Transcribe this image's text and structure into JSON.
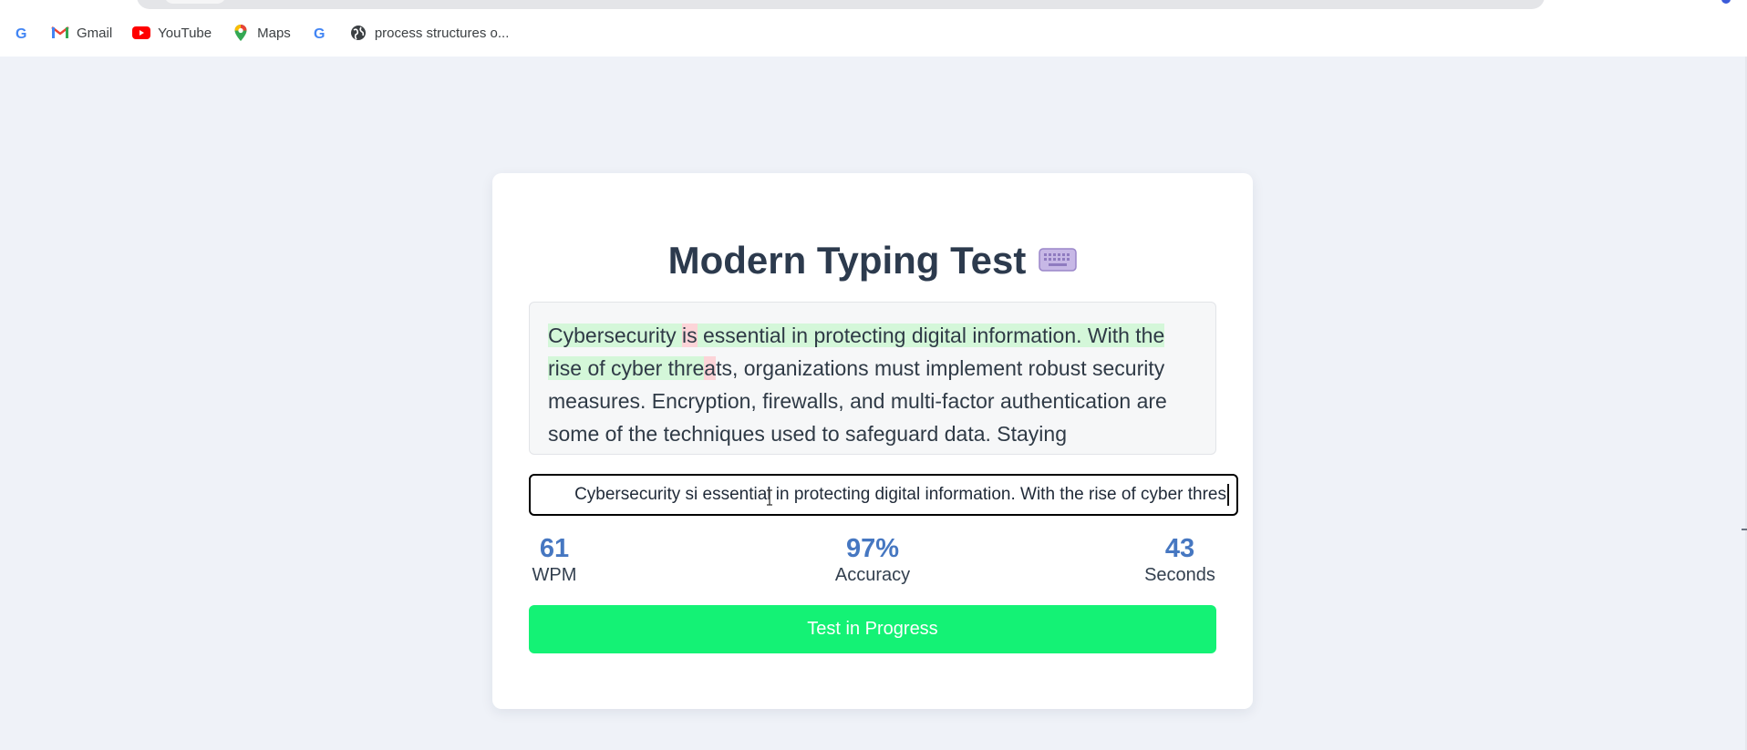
{
  "browser": {
    "bookmarks": [
      {
        "label": "",
        "icon": "google-icon"
      },
      {
        "label": "Gmail",
        "icon": "gmail-icon"
      },
      {
        "label": "YouTube",
        "icon": "youtube-icon"
      },
      {
        "label": "Maps",
        "icon": "maps-icon"
      },
      {
        "label": "",
        "icon": "google-icon"
      },
      {
        "label": "process structures o...",
        "icon": "globe-icon"
      }
    ]
  },
  "app": {
    "title": "Modern Typing Test",
    "title_icon": "keyboard-icon",
    "passage": {
      "segments": [
        {
          "text": "Cybersecurity ",
          "state": "correct"
        },
        {
          "text": "is",
          "state": "incorrect"
        },
        {
          "text": " essential in protecting digital information. With the rise of cyber thre",
          "state": "correct"
        },
        {
          "text": "a",
          "state": "incorrect"
        },
        {
          "text": "ts, organizations must implement robust security measures. Encryption, firewalls, and multi-factor authentication are some of the techniques used to safeguard data. Staying",
          "state": "pending"
        }
      ]
    },
    "input": {
      "value": "Cybersecurity si essential in protecting digital information. With the rise of cyber thres"
    },
    "stats": {
      "wpm": {
        "value": "61",
        "label": "WPM"
      },
      "accuracy": {
        "value": "97%",
        "label": "Accuracy"
      },
      "seconds": {
        "value": "43",
        "label": "Seconds"
      }
    },
    "button_label": "Test in Progress"
  },
  "colors": {
    "correct_highlight": "#d4f7d9",
    "incorrect_highlight": "#fcd4d8",
    "stat_value": "#4677c1",
    "button": "#14f275",
    "title": "#2c3a4d",
    "background": "#eff2f8"
  }
}
